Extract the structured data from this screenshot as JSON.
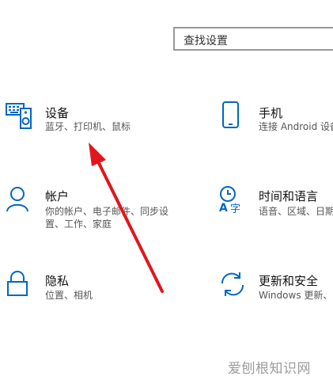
{
  "search": {
    "placeholder": "查找设置"
  },
  "tiles": [
    {
      "title": "设备",
      "desc": [
        "蓝牙、打印机、鼠标"
      ],
      "icon": "keyboard-speaker-icon"
    },
    {
      "title": "手机",
      "desc": [
        "连接 Android 设备"
      ],
      "icon": "phone-icon"
    },
    {
      "title": "帐户",
      "desc": [
        "你的帐户、电子邮件、同步设",
        "置、工作、家庭"
      ],
      "icon": "person-icon"
    },
    {
      "title": "时间和语言",
      "desc": [
        "语音、区域、日期"
      ],
      "icon": "clock-language-icon"
    },
    {
      "title": "隐私",
      "desc": [
        "位置、相机"
      ],
      "icon": "lock-icon"
    },
    {
      "title": "更新和安全",
      "desc": [
        "Windows 更新、"
      ],
      "icon": "sync-icon"
    }
  ],
  "watermark": "爱刨根知识网",
  "colors": {
    "accent": "#0067c0",
    "annotation": "#e0161c"
  }
}
